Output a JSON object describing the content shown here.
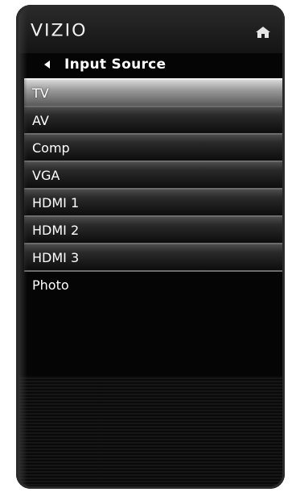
{
  "app": {
    "brand": "VIZIO"
  },
  "header": {
    "home_icon": "home-icon"
  },
  "title_bar": {
    "back_icon": "triangle-left-icon",
    "title": "Input Source"
  },
  "menu": {
    "items": [
      {
        "label": "TV",
        "selected": true
      },
      {
        "label": "AV",
        "selected": false
      },
      {
        "label": "Comp",
        "selected": false
      },
      {
        "label": "VGA",
        "selected": false
      },
      {
        "label": "HDMI 1",
        "selected": false
      },
      {
        "label": "HDMI 2",
        "selected": false
      },
      {
        "label": "HDMI 3",
        "selected": false
      },
      {
        "label": "Photo",
        "selected": false
      }
    ]
  },
  "colors": {
    "background": "#050505",
    "text": "#ffffff",
    "selected_highlight": "#a0a0a0"
  }
}
